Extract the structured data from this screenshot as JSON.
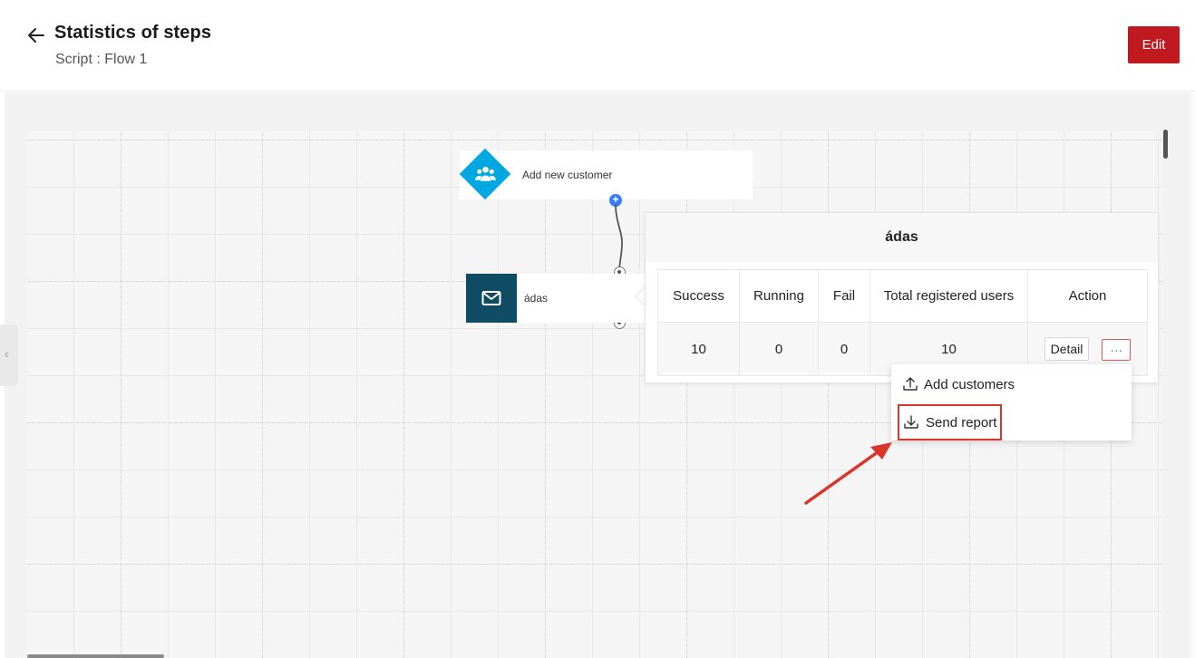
{
  "header": {
    "title": "Statistics of steps",
    "subtitle": "Script : Flow 1",
    "edit_label": "Edit"
  },
  "flow": {
    "trigger_node": {
      "label": "Add new customer",
      "icon": "users-icon",
      "color": "#00a7e1"
    },
    "email_node": {
      "label": "ádas",
      "icon": "mail-icon",
      "color": "#0f4c64"
    }
  },
  "popup": {
    "title": "ádas",
    "columns": [
      "Success",
      "Running",
      "Fail",
      "Total registered users",
      "Action"
    ],
    "row": {
      "success": "10",
      "running": "0",
      "fail": "0",
      "total": "10"
    },
    "detail_label": "Detail",
    "more_label": "···"
  },
  "menu": {
    "items": [
      {
        "label": "Add customers",
        "icon": "upload-icon"
      },
      {
        "label": "Send report",
        "icon": "download-icon"
      }
    ]
  },
  "colors": {
    "accent": "#c0191f",
    "highlight": "#d9352b",
    "link": "#3a7cf5"
  }
}
